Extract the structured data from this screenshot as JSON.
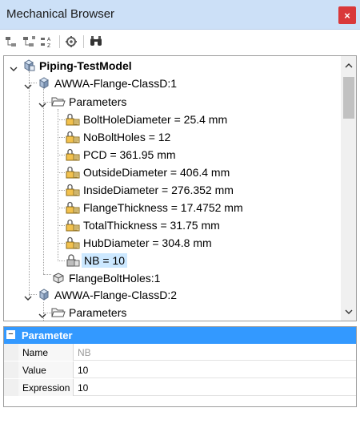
{
  "window": {
    "title": "Mechanical Browser",
    "close_glyph": "×"
  },
  "toolbar": {
    "buttons": [
      "collapse-all-icon",
      "expand-all-icon",
      "sort-az-icon",
      "settings-filter-icon",
      "find-icon"
    ]
  },
  "tree": {
    "root": "Piping-TestModel",
    "nodes": [
      {
        "label": "AWWA-Flange-ClassD:1"
      },
      {
        "label": "Parameters"
      },
      {
        "label": "BoltHoleDiameter = 25.4 mm"
      },
      {
        "label": "NoBoltHoles = 12"
      },
      {
        "label": "PCD = 361.95 mm"
      },
      {
        "label": "OutsideDiameter = 406.4 mm"
      },
      {
        "label": "InsideDiameter = 276.352 mm"
      },
      {
        "label": "FlangeThickness = 17.4752 mm"
      },
      {
        "label": "TotalThickness = 31.75 mm"
      },
      {
        "label": "HubDiameter = 304.8 mm"
      },
      {
        "label": "NB = 10"
      },
      {
        "label": "FlangeBoltHoles:1"
      },
      {
        "label": "AWWA-Flange-ClassD:2"
      },
      {
        "label": "Parameters"
      }
    ],
    "selected": "NB = 10"
  },
  "properties": {
    "category": "Parameter",
    "collapse_glyph": "−",
    "rows": [
      {
        "name": "Name",
        "value": "NB"
      },
      {
        "name": "Value",
        "value": "10"
      },
      {
        "name": "Expression",
        "value": "10"
      }
    ]
  },
  "colors": {
    "titlebar": "#cce0f7",
    "close": "#d9383a",
    "accent": "#3399ff",
    "selection": "#cce8ff"
  }
}
